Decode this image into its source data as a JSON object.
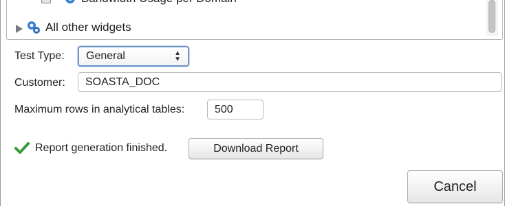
{
  "widgets": {
    "items": [
      {
        "label": "Bandwidth Usage per Domain",
        "checked": true,
        "icon": "gear-icon"
      },
      {
        "label": "All other widgets",
        "expanded": false,
        "icon": "gear-icon"
      }
    ]
  },
  "form": {
    "test_type_label": "Test Type:",
    "test_type_value": "General",
    "customer_label": "Customer:",
    "customer_value": "SOASTA_DOC",
    "max_rows_label": "Maximum rows in analytical tables:",
    "max_rows_value": "500"
  },
  "status": {
    "message": "Report generation finished.",
    "icon": "checkmark-icon",
    "color": "#3a9a3a"
  },
  "buttons": {
    "download_label": "Download Report",
    "cancel_label": "Cancel"
  }
}
